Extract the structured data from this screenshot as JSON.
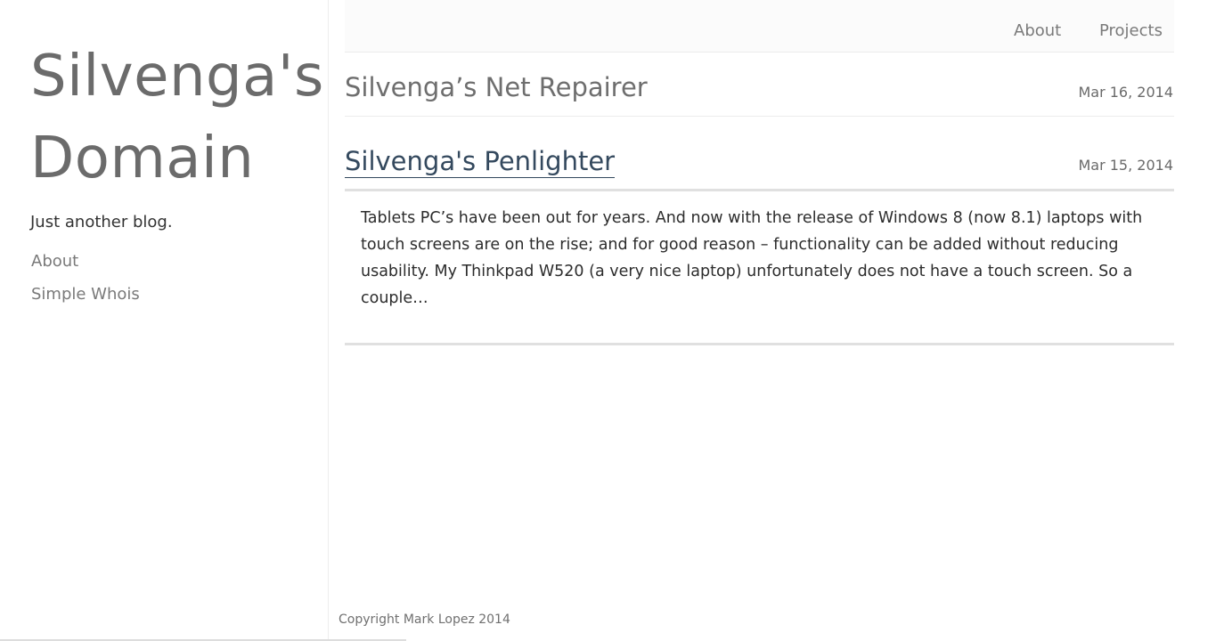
{
  "sidebar": {
    "title": "Silvenga's Domain",
    "tagline": "Just another blog.",
    "links": [
      {
        "label": "About"
      },
      {
        "label": "Simple Whois"
      }
    ]
  },
  "topnav": {
    "links": [
      {
        "label": "About"
      },
      {
        "label": "Projects"
      }
    ]
  },
  "posts": [
    {
      "title": "Silvenga’s Net Repairer",
      "date": "Mar 16, 2014"
    },
    {
      "title": "Silvenga's Penlighter",
      "date": "Mar 15, 2014",
      "excerpt": "Tablets PC’s have been out for years. And now with the release of Windows 8 (now 8.1) laptops with touch screens are on the rise; and for good reason – functionality can be added without reducing usability. My Thinkpad W520 (a very nice laptop) unfortunately does not have a touch screen. So a couple…"
    }
  ],
  "footer": {
    "copyright": "Copyright Mark Lopez 2014"
  },
  "colors": {
    "link_active": "#34495e",
    "text_muted": "#6e6e6e",
    "divider": "#e0e0e0"
  }
}
